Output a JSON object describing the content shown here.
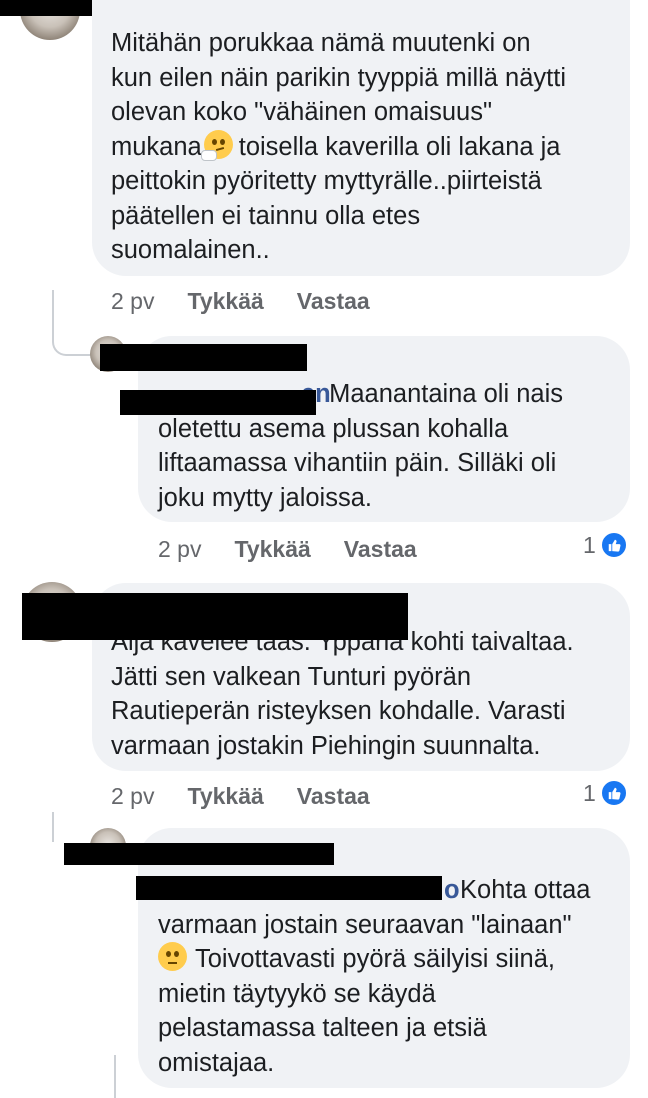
{
  "comments": [
    {
      "lines": [
        "Mitähän porukkaa nämä muutenki on",
        "kun eilen näin parikin tyyppiä millä näytti",
        "olevan koko \"vähäinen omaisuus\"",
        "toisella kaverilla oli lakana ja",
        "peittokin pyöritetty myttyrälle..piirteistä",
        "päätellen ei tainnu olla etes",
        "suomalainen.."
      ],
      "line4_prefix": "mukana",
      "emoji": "thinking-face-emoji",
      "time": "2 pv",
      "like": "Tykkää",
      "reply": "Vastaa"
    },
    {
      "mention_suffix": "en",
      "lines": [
        "Maanantaina oli nais",
        "oletettu asema plussan kohalla",
        "liftaamassa vihantiin päin.  Silläki oli",
        "joku mytty jaloissa."
      ],
      "time": "2 pv",
      "like": "Tykkää",
      "reply": "Vastaa",
      "reactions": "1"
    },
    {
      "lines": [
        "Äijä kävelee taas. Yppäriä kohti taivaltaa.",
        "Jätti sen valkean Tunturi pyörän",
        "Rautieperän risteyksen kohdalle. Varasti",
        "varmaan jostakin Piehingin suunnalta."
      ],
      "time": "2 pv",
      "like": "Tykkää",
      "reply": "Vastaa",
      "reactions": "1"
    },
    {
      "mention_suffix": "o",
      "lines": [
        "Kohta ottaa",
        "varmaan jostain seuraavan \"lainaan\"",
        "Toivottavasti pyörä säilyisi siinä,",
        "mietin täytyykö se käydä",
        "pelastamassa talteen ja etsiä",
        "omistajaa."
      ],
      "emoji": "eye-roll-emoji"
    }
  ],
  "colors": {
    "bubble": "#f0f2f5",
    "link": "#385898",
    "meta": "#65676b",
    "like_blue": "#1877f2"
  }
}
